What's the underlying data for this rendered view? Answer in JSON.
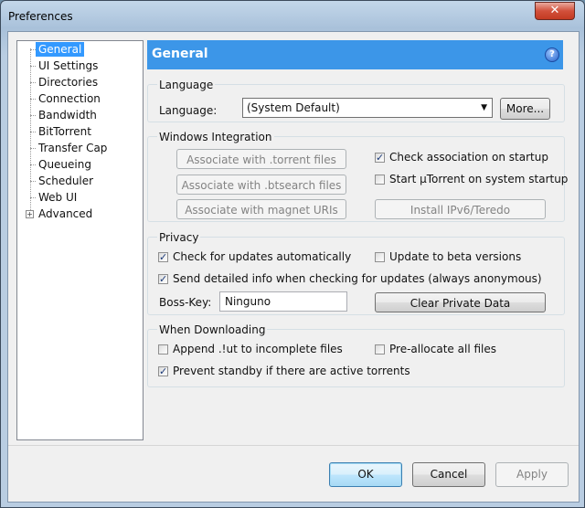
{
  "window": {
    "title": "Preferences",
    "close_glyph": "✕"
  },
  "tree": {
    "items": [
      {
        "label": "General",
        "selected": true
      },
      {
        "label": "UI Settings"
      },
      {
        "label": "Directories"
      },
      {
        "label": "Connection"
      },
      {
        "label": "Bandwidth"
      },
      {
        "label": "BitTorrent"
      },
      {
        "label": "Transfer Cap"
      },
      {
        "label": "Queueing"
      },
      {
        "label": "Scheduler"
      },
      {
        "label": "Web UI"
      },
      {
        "label": "Advanced",
        "expandable": true
      }
    ],
    "expander_glyph": "+"
  },
  "header": {
    "title": "General",
    "help_glyph": "?"
  },
  "language": {
    "group_title": "Language",
    "label": "Language:",
    "value": "(System Default)",
    "arrow": "▼",
    "more_button": "More..."
  },
  "windows_integration": {
    "group_title": "Windows Integration",
    "assoc_torrent": "Associate with .torrent files",
    "assoc_btsearch": "Associate with .btsearch files",
    "assoc_magnet": "Associate with magnet URIs",
    "check_assoc": {
      "label": "Check association on startup",
      "checked": true
    },
    "start_on_startup": {
      "label": "Start µTorrent on system startup",
      "checked": false
    },
    "install_ipv6": "Install IPv6/Teredo"
  },
  "privacy": {
    "group_title": "Privacy",
    "check_updates": {
      "label": "Check for updates automatically",
      "checked": true
    },
    "beta": {
      "label": "Update to beta versions",
      "checked": false
    },
    "send_info": {
      "label": "Send detailed info when checking for updates (always anonymous)",
      "checked": true
    },
    "boss_key_label": "Boss-Key:",
    "boss_key_value": "Ninguno",
    "clear_private": "Clear Private Data"
  },
  "downloading": {
    "group_title": "When Downloading",
    "append_lut": {
      "label": "Append .!ut to incomplete files",
      "checked": false
    },
    "preallocate": {
      "label": "Pre-allocate all files",
      "checked": false
    },
    "prevent_standby": {
      "label": "Prevent standby if there are active torrents",
      "checked": true
    }
  },
  "footer": {
    "ok": "OK",
    "cancel": "Cancel",
    "apply": "Apply"
  },
  "check_glyph": "✓"
}
